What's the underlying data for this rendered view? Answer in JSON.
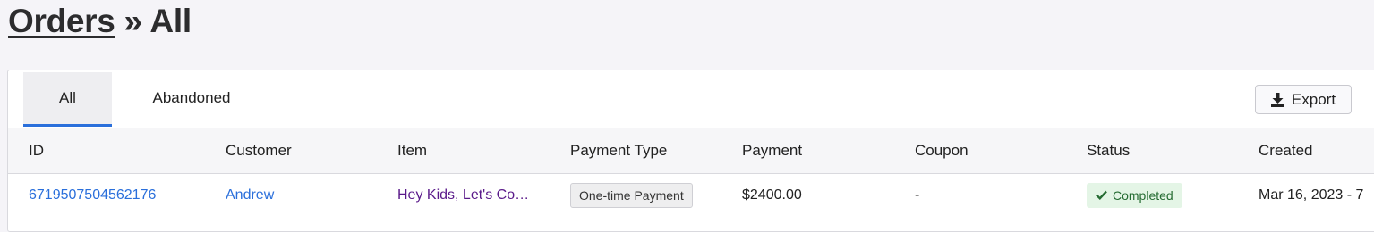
{
  "breadcrumb": {
    "link": "Orders",
    "separator": " » ",
    "current": "All"
  },
  "tabs": [
    {
      "label": "All",
      "active": true
    },
    {
      "label": "Abandoned",
      "active": false
    }
  ],
  "toolbar": {
    "export_label": "Export",
    "export_icon": "download-icon"
  },
  "table": {
    "columns": [
      "ID",
      "Customer",
      "Item",
      "Payment Type",
      "Payment",
      "Coupon",
      "Status",
      "Created"
    ],
    "rows": [
      {
        "id": "6719507504562176",
        "customer": "Andrew",
        "item": "Hey Kids, Let's Code!",
        "payment_type": "One-time Payment",
        "payment": "$2400.00",
        "coupon": "-",
        "status": "Completed",
        "status_icon": "check-icon",
        "created": "Mar 16, 2023 - 7"
      }
    ]
  },
  "colors": {
    "accent": "#2a6fdb",
    "item_link": "#5a1a8a",
    "status_completed_bg": "#e4f5e6",
    "status_completed_text": "#256b32"
  }
}
